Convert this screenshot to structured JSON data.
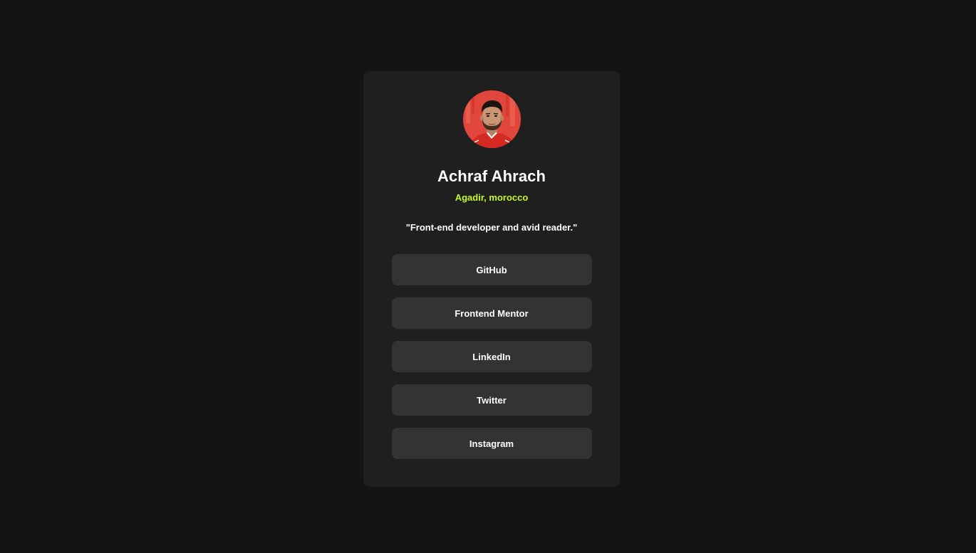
{
  "profile": {
    "name": "Achraf Ahrach",
    "location": "Agadir, morocco",
    "bio": "\"Front-end developer and avid reader.\""
  },
  "links": [
    {
      "label": "GitHub"
    },
    {
      "label": "Frontend Mentor"
    },
    {
      "label": "LinkedIn"
    },
    {
      "label": "Twitter"
    },
    {
      "label": "Instagram"
    }
  ],
  "colors": {
    "background": "#141414",
    "card": "#1f1f1f",
    "button": "#333333",
    "accent": "#c4f82a",
    "text": "#ffffff"
  }
}
